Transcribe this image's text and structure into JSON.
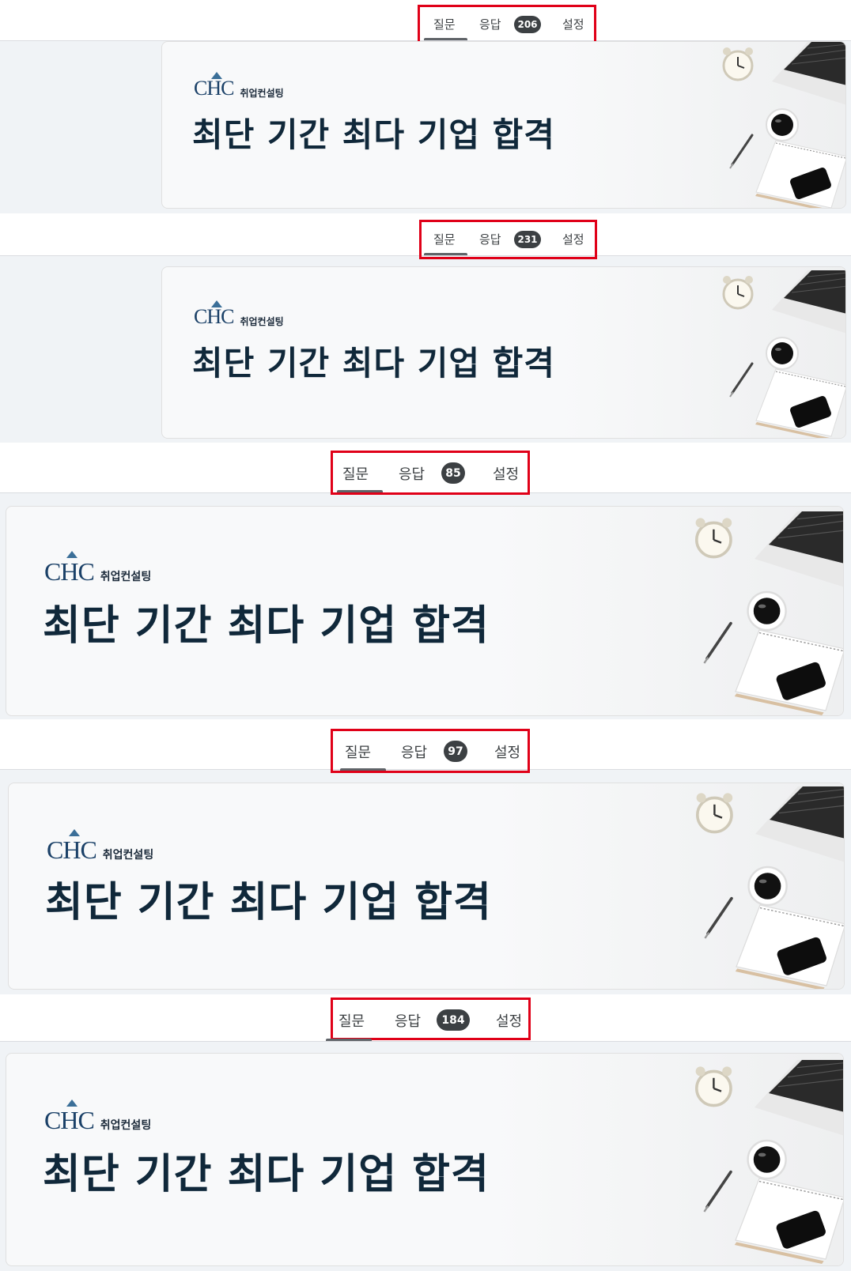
{
  "panels": [
    {
      "tabs": {
        "question": "질문",
        "response": "응답",
        "count": "206",
        "settings": "설정"
      },
      "banner": {
        "logo": "CHC",
        "logo_sub": "취업컨설팅",
        "headline": "최단 기간 최다 기업 합격"
      }
    },
    {
      "tabs": {
        "question": "질문",
        "response": "응답",
        "count": "231",
        "settings": "설정"
      },
      "banner": {
        "logo": "CHC",
        "logo_sub": "취업컨설팅",
        "headline": "최단 기간 최다 기업 합격"
      }
    },
    {
      "tabs": {
        "question": "질문",
        "response": "응답",
        "count": "85",
        "settings": "설정"
      },
      "banner": {
        "logo": "CHC",
        "logo_sub": "취업컨설팅",
        "headline": "최단 기간 최다 기업 합격"
      }
    },
    {
      "tabs": {
        "question": "질문",
        "response": "응답",
        "count": "97",
        "settings": "설정"
      },
      "banner": {
        "logo": "CHC",
        "logo_sub": "취업컨설팅",
        "headline": "최단 기간 최다 기업 합격"
      }
    },
    {
      "tabs": {
        "question": "질문",
        "response": "응답",
        "count": "184",
        "settings": "설정"
      },
      "banner": {
        "logo": "CHC",
        "logo_sub": "취업컨설팅",
        "headline": "최단 기간 최다 기업 합격"
      }
    }
  ],
  "colors": {
    "highlight_border": "#e00018",
    "headline": "#10283a",
    "logo": "#1b4168",
    "badge": "#3c4043"
  },
  "icons": [
    "alarm-clock-icon",
    "laptop-icon",
    "coffee-cup-icon",
    "pen-icon",
    "notebook-icon",
    "smartphone-icon"
  ]
}
